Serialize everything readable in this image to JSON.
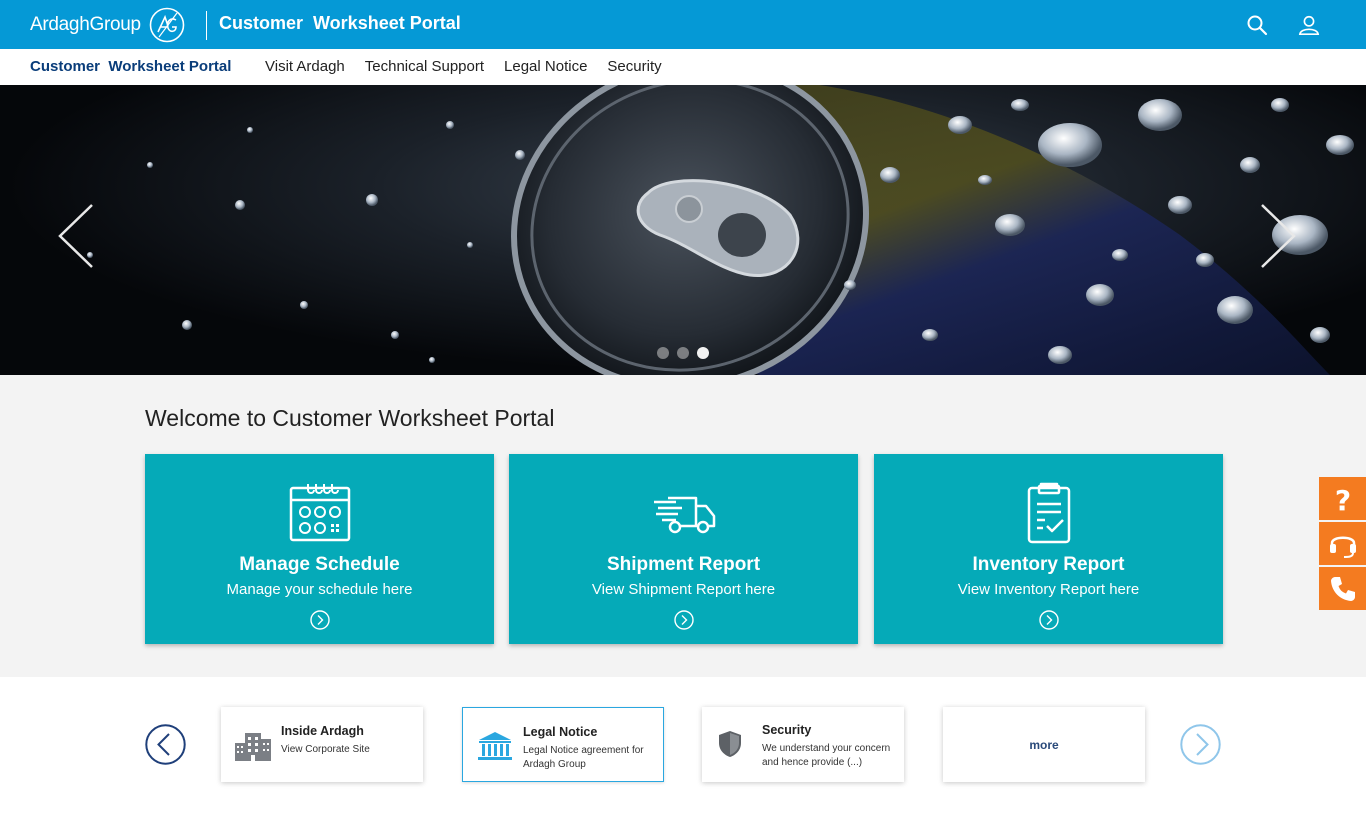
{
  "header": {
    "logo_text": "ArdaghGroup",
    "app_title": "Customer  Worksheet Portal",
    "search_icon": "search-icon",
    "user_icon": "user-icon",
    "bar_color": "#0599d6"
  },
  "nav": {
    "brand": "Customer  Worksheet Portal",
    "links": [
      "Visit Ardagh",
      "Technical Support",
      "Legal Notice",
      "Security"
    ]
  },
  "hero": {
    "slides_count": 3,
    "active_slide": 3,
    "prev_icon": "chevron-left-icon",
    "next_icon": "chevron-right-icon"
  },
  "welcome": {
    "title": "Welcome to Customer Worksheet Portal",
    "tile_color": "#05aab8",
    "tiles": [
      {
        "title": "Manage Schedule",
        "subtitle": "Manage your schedule here",
        "icon": "calendar-icon"
      },
      {
        "title": "Shipment Report",
        "subtitle": "View Shipment Report here",
        "icon": "truck-icon"
      },
      {
        "title": "Inventory Report",
        "subtitle": "View Inventory Report here",
        "icon": "clipboard-check-icon"
      }
    ]
  },
  "side_help": {
    "color": "#f47b20",
    "buttons": [
      "question-icon",
      "headset-icon",
      "phone-icon"
    ]
  },
  "links": {
    "cards": [
      {
        "title": "Inside Ardagh",
        "desc": "View Corporate Site",
        "icon": "building-icon"
      },
      {
        "title": "Legal Notice",
        "desc": "Legal Notice agreement for Ardagh Group",
        "icon": "bank-icon"
      },
      {
        "title": "Security",
        "desc": "We understand your concern and hence provide (...)",
        "icon": "shield-icon"
      }
    ],
    "more_label": "more"
  }
}
